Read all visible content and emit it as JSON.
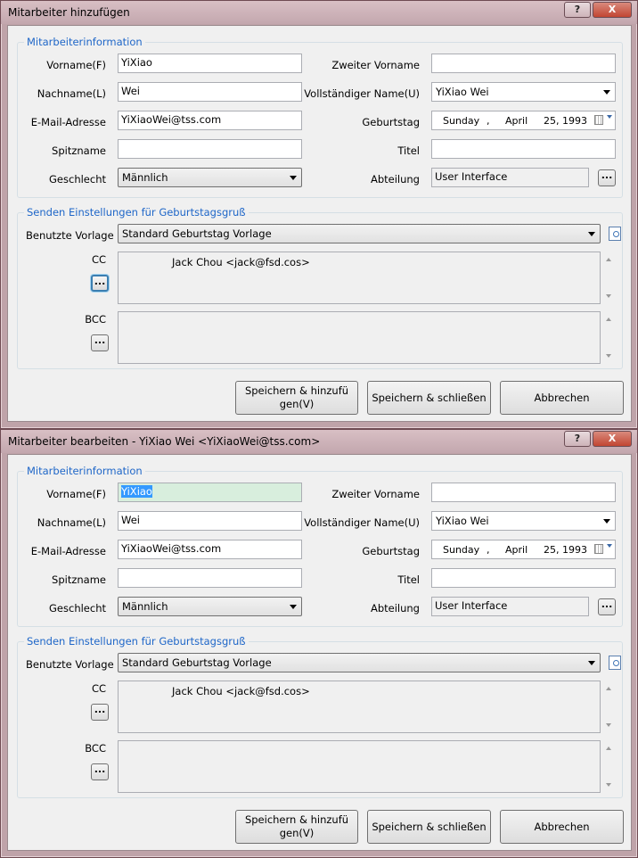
{
  "windows": [
    {
      "title": "Mitarbeiter hinzufügen",
      "help_label": "?",
      "close_label": "X",
      "employee_group_title": "Mitarbeiterinformation",
      "first_name_label": "Vorname(F)",
      "first_name_value": "YiXiao",
      "last_name_label": "Nachname(L)",
      "last_name_value": "Wei",
      "email_label": "E-Mail-Adresse",
      "email_value": "YiXiaoWei@tss.com",
      "nickname_label": "Spitzname",
      "nickname_value": "",
      "gender_label": "Geschlecht",
      "gender_value": "Männlich",
      "middle_name_label": "Zweiter Vorname",
      "middle_name_value": "",
      "full_name_label": "Vollständiger Name(U)",
      "full_name_value": "YiXiao Wei",
      "birthday_label": "Geburtstag",
      "birthday_weekday": "Sunday",
      "birthday_sep": ",",
      "birthday_month": "April",
      "birthday_day_year": "25, 1993",
      "title_label": "Titel",
      "title_value": "",
      "department_label": "Abteilung",
      "department_value": "User Interface",
      "ellipsis": "...",
      "greeting_group_title": "Senden Einstellungen für Geburtstagsgruß",
      "template_label": "Benutzte Vorlage",
      "template_value": "Standard Geburtstag Vorlage",
      "cc_label": "CC",
      "cc_value": "Jack Chou <jack@fsd.cos>",
      "bcc_label": "BCC",
      "bcc_value": "",
      "save_add_line1": "Speichern & hinzufü",
      "save_add_line2": "gen(V)",
      "save_close_label": "Speichern & schließen",
      "cancel_label": "Abbrechen"
    },
    {
      "title": "Mitarbeiter bearbeiten - YiXiao Wei <YiXiaoWei@tss.com>",
      "help_label": "?",
      "close_label": "X",
      "employee_group_title": "Mitarbeiterinformation",
      "first_name_label": "Vorname(F)",
      "first_name_value": "YiXiao",
      "last_name_label": "Nachname(L)",
      "last_name_value": "Wei",
      "email_label": "E-Mail-Adresse",
      "email_value": "YiXiaoWei@tss.com",
      "nickname_label": "Spitzname",
      "nickname_value": "",
      "gender_label": "Geschlecht",
      "gender_value": "Männlich",
      "middle_name_label": "Zweiter Vorname",
      "middle_name_value": "",
      "full_name_label": "Vollständiger Name(U)",
      "full_name_value": "YiXiao Wei",
      "birthday_label": "Geburtstag",
      "birthday_weekday": "Sunday",
      "birthday_sep": ",",
      "birthday_month": "April",
      "birthday_day_year": "25, 1993",
      "title_label": "Titel",
      "title_value": "",
      "department_label": "Abteilung",
      "department_value": "User Interface",
      "ellipsis": "...",
      "greeting_group_title": "Senden Einstellungen für Geburtstagsgruß",
      "template_label": "Benutzte Vorlage",
      "template_value": "Standard Geburtstag Vorlage",
      "cc_label": "CC",
      "cc_value": "Jack Chou <jack@fsd.cos>",
      "bcc_label": "BCC",
      "bcc_value": "",
      "save_add_line1": "Speichern & hinzufü",
      "save_add_line2": "gen(V)",
      "save_close_label": "Speichern & schließen",
      "cancel_label": "Abbrechen"
    }
  ],
  "colors": {
    "frame": "#bfa3a9",
    "group_title": "#1e66c8",
    "selection": "#3399ff",
    "close_button": "#c24632"
  }
}
